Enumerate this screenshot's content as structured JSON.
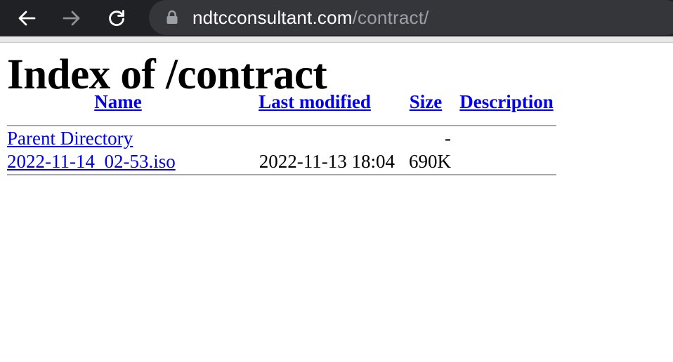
{
  "browser": {
    "url_host": "ndtcconsultant.com",
    "url_path": "/contract/",
    "icons": [
      "back-arrow-icon",
      "forward-arrow-icon",
      "reload-icon",
      "lock-icon"
    ]
  },
  "page": {
    "title": "Index of /contract"
  },
  "table": {
    "headers": {
      "name": "Name",
      "last_modified": "Last modified",
      "size": "Size",
      "description": "Description"
    },
    "rows": [
      {
        "name": "Parent Directory",
        "last_modified": "",
        "size": "-",
        "description": ""
      },
      {
        "name": "2022-11-14_02-53.iso",
        "last_modified": "2022-11-13 18:04",
        "size": "690K",
        "description": ""
      }
    ]
  },
  "colors": {
    "link": "#0000ee",
    "toolbar_bg": "#202124",
    "omnibox_bg": "#35363a"
  }
}
